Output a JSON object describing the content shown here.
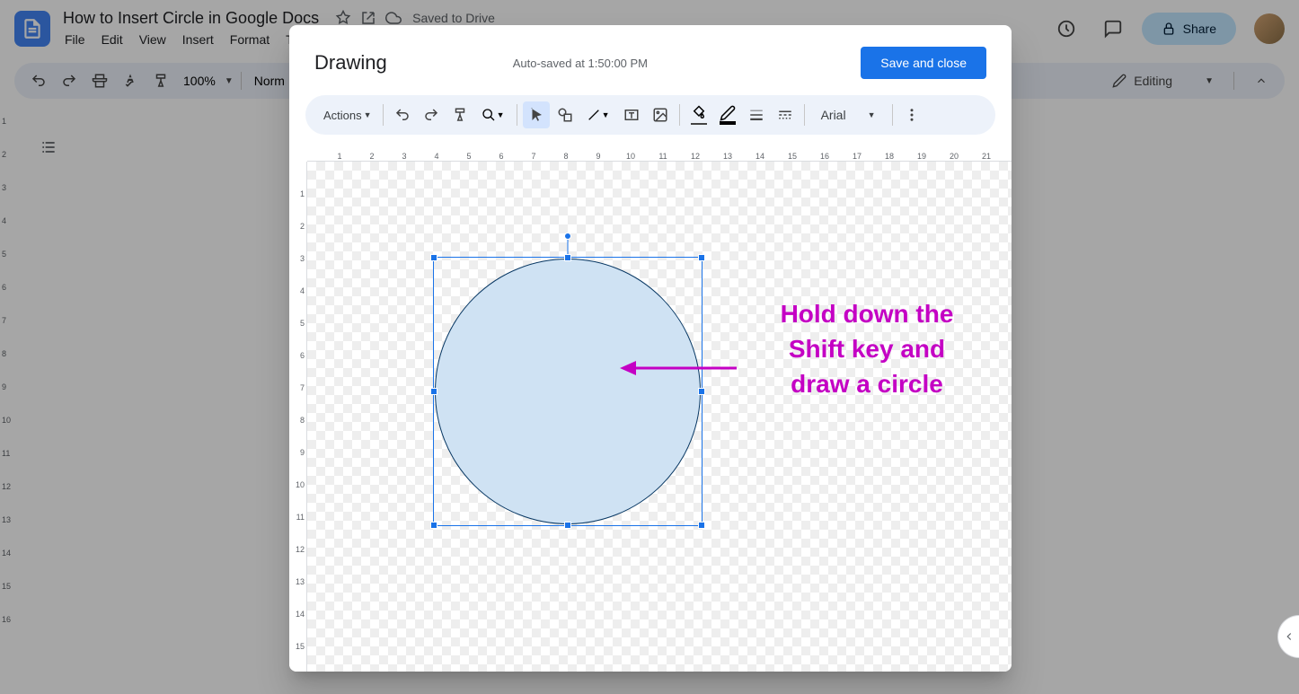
{
  "docs": {
    "title": "How to Insert Circle in Google Docs",
    "saved": "Saved to Drive",
    "menus": [
      "File",
      "Edit",
      "View",
      "Insert",
      "Format",
      "To"
    ],
    "zoom": "100%",
    "style": "Norm",
    "editing": "Editing",
    "share": "Share",
    "ruler_v": [
      "1",
      "2",
      "3",
      "4",
      "5",
      "6",
      "7",
      "8",
      "9",
      "10",
      "11",
      "12",
      "13",
      "14",
      "15",
      "16"
    ]
  },
  "modal": {
    "title": "Drawing",
    "autosave": "Auto-saved at 1:50:00 PM",
    "save_close": "Save and close",
    "actions": "Actions",
    "font": "Arial",
    "ruler_h": [
      "1",
      "2",
      "3",
      "4",
      "5",
      "6",
      "7",
      "8",
      "9",
      "10",
      "11",
      "12",
      "13",
      "14",
      "15",
      "16",
      "17",
      "18",
      "19",
      "20",
      "21"
    ],
    "ruler_v": [
      "1",
      "2",
      "3",
      "4",
      "5",
      "6",
      "7",
      "8",
      "9",
      "10",
      "11",
      "12",
      "13",
      "14",
      "15"
    ]
  },
  "annotation": {
    "line1": "Hold down the",
    "line2": "Shift key and",
    "line3": "draw a circle"
  }
}
